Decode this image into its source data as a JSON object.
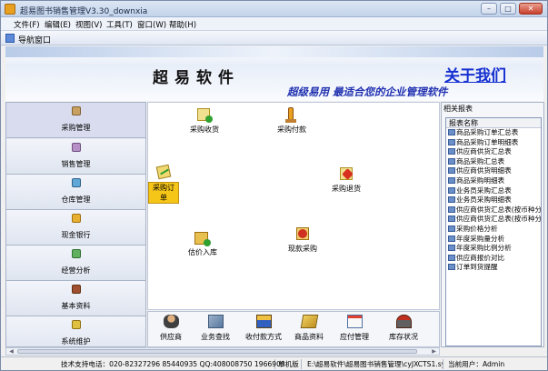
{
  "window": {
    "title": "超易图书销售管理V3.30_downxia",
    "min_label": "–",
    "max_label": "□",
    "close_label": "✕"
  },
  "menu": [
    "文件(F)",
    "编辑(E)",
    "视图(V)",
    "工具(T)",
    "窗口(W)",
    "帮助(H)"
  ],
  "tab": {
    "label": "导航窗口"
  },
  "banner": {
    "brand": "超易软件",
    "about": "关于我们",
    "slogan": "超级易用 最适合您的企业管理软件"
  },
  "left_nav": [
    {
      "label": "采购管理",
      "icon": "purchase-icon",
      "active": true
    },
    {
      "label": "销售管理",
      "icon": "sales-icon"
    },
    {
      "label": "仓库管理",
      "icon": "warehouse-icon"
    },
    {
      "label": "现金银行",
      "icon": "cash-bank-icon"
    },
    {
      "label": "经营分析",
      "icon": "analysis-icon"
    },
    {
      "label": "基本资料",
      "icon": "basic-data-icon"
    },
    {
      "label": "系统维护",
      "icon": "maintenance-icon"
    }
  ],
  "center_items": [
    {
      "label": "采购收货",
      "icon": "receive-goods-icon",
      "highlighted": false
    },
    {
      "label": "采购付款",
      "icon": "payment-icon",
      "highlighted": false
    },
    {
      "label": "采购订单",
      "icon": "purchase-order-icon",
      "highlighted": true
    },
    {
      "label": "采购退货",
      "icon": "purchase-return-icon",
      "highlighted": false
    },
    {
      "label": "估价入库",
      "icon": "estimate-stock-in-icon",
      "highlighted": false
    },
    {
      "label": "现款采购",
      "icon": "cash-purchase-icon",
      "highlighted": false
    }
  ],
  "toolbar": [
    {
      "label": "供应商",
      "icon": "supplier-icon"
    },
    {
      "label": "业务查找",
      "icon": "business-search-icon"
    },
    {
      "label": "收付款方式",
      "icon": "payment-method-icon"
    },
    {
      "label": "商品资料",
      "icon": "goods-data-icon"
    },
    {
      "label": "应付管理",
      "icon": "payable-icon"
    },
    {
      "label": "库存状况",
      "icon": "inventory-icon"
    }
  ],
  "reports": {
    "title": "相关报表",
    "header": "报表名称",
    "items": [
      "商品采购订单汇总表",
      "商品采购订单明细表",
      "供应商供货汇总表",
      "商品采购汇总表",
      "供应商供货明细表",
      "商品采购明细表",
      "业务员采购汇总表",
      "业务员采购明细表",
      "供应商供货汇总表(按币种分",
      "供应商供货汇总表(按币种分",
      "采购价格分析",
      "年度采购量分析",
      "年度采购比例分析",
      "供应商报价对比",
      "订单到货提醒"
    ]
  },
  "status": {
    "support": "技术支持电话：020-82327296 85440935 QQ:408008750 1966903",
    "version": "单机版",
    "path": "E:\\超易软件\\超易图书销售管理\\cyJXCTS1.sys",
    "user": "当前用户：Admin"
  },
  "colors": {
    "accent_blue": "#1530d0",
    "highlight": "#f5c518",
    "titlebar": "#c3d3ea"
  }
}
